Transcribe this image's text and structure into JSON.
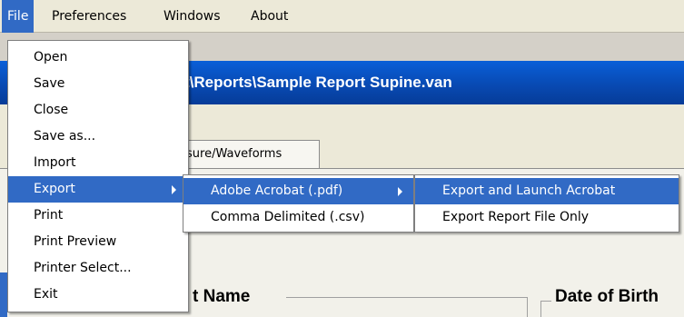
{
  "menubar": {
    "items": [
      {
        "label": "File"
      },
      {
        "label": "Preferences"
      },
      {
        "label": "Windows"
      },
      {
        "label": "About"
      }
    ]
  },
  "app": {
    "title": "ort\\Reports\\Sample Report Supine.van",
    "tab_label": "sure/Waveforms",
    "name_label": "t Name",
    "dob_label": "Date of Birth"
  },
  "file_menu": {
    "items": [
      {
        "label": "Open"
      },
      {
        "label": "Save"
      },
      {
        "label": "Close"
      },
      {
        "label": "Save as..."
      },
      {
        "label": "Import"
      },
      {
        "label": "Export"
      },
      {
        "label": "Print"
      },
      {
        "label": "Print Preview"
      },
      {
        "label": "Printer Select..."
      },
      {
        "label": "Exit"
      }
    ]
  },
  "export_menu": {
    "items": [
      {
        "label": "Adobe Acrobat (.pdf)"
      },
      {
        "label": "Comma Delimited (.csv)"
      }
    ]
  },
  "acrobat_menu": {
    "items": [
      {
        "label": "Export and Launch Acrobat"
      },
      {
        "label": "Export Report File Only"
      }
    ]
  },
  "colors": {
    "highlight": "#316ac5",
    "title_bar": "#0848b0",
    "menubar_bg": "#ece9d8"
  }
}
